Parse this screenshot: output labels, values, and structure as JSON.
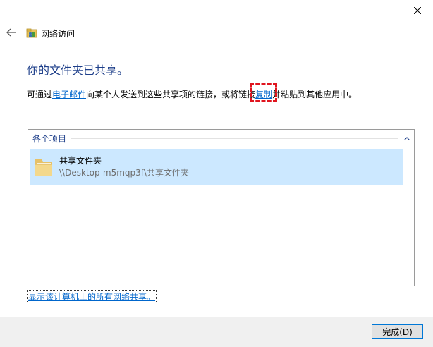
{
  "window": {
    "title": "网络访问"
  },
  "main": {
    "heading": "你的文件夹已共享。",
    "desc_part1": "可通过",
    "desc_link_email": "电子邮件",
    "desc_part2": "向某个人发送到这些共享项的链接，或将链接",
    "desc_link_copy": "复制",
    "desc_part3": "并粘贴到其他应用中。"
  },
  "list": {
    "group_label": "各个项目",
    "items": [
      {
        "name": "共享文件夹",
        "path": "\\\\Desktop-m5mqp3f\\共享文件夹"
      }
    ]
  },
  "links": {
    "show_all": "显示该计算机上的所有网络共享。"
  },
  "footer": {
    "done_label": "完成(D)"
  },
  "colors": {
    "heading": "#1e3f8a",
    "link": "#0066cc",
    "selection": "#cce8ff",
    "highlight": "#e0141e",
    "footer_bg": "#f0f0f0",
    "button_border": "#0078d7"
  },
  "icons": {
    "close": "close-icon",
    "back": "back-arrow-icon",
    "app": "network-share-icon",
    "collapse": "chevron-up-icon",
    "item": "folder-icon"
  }
}
